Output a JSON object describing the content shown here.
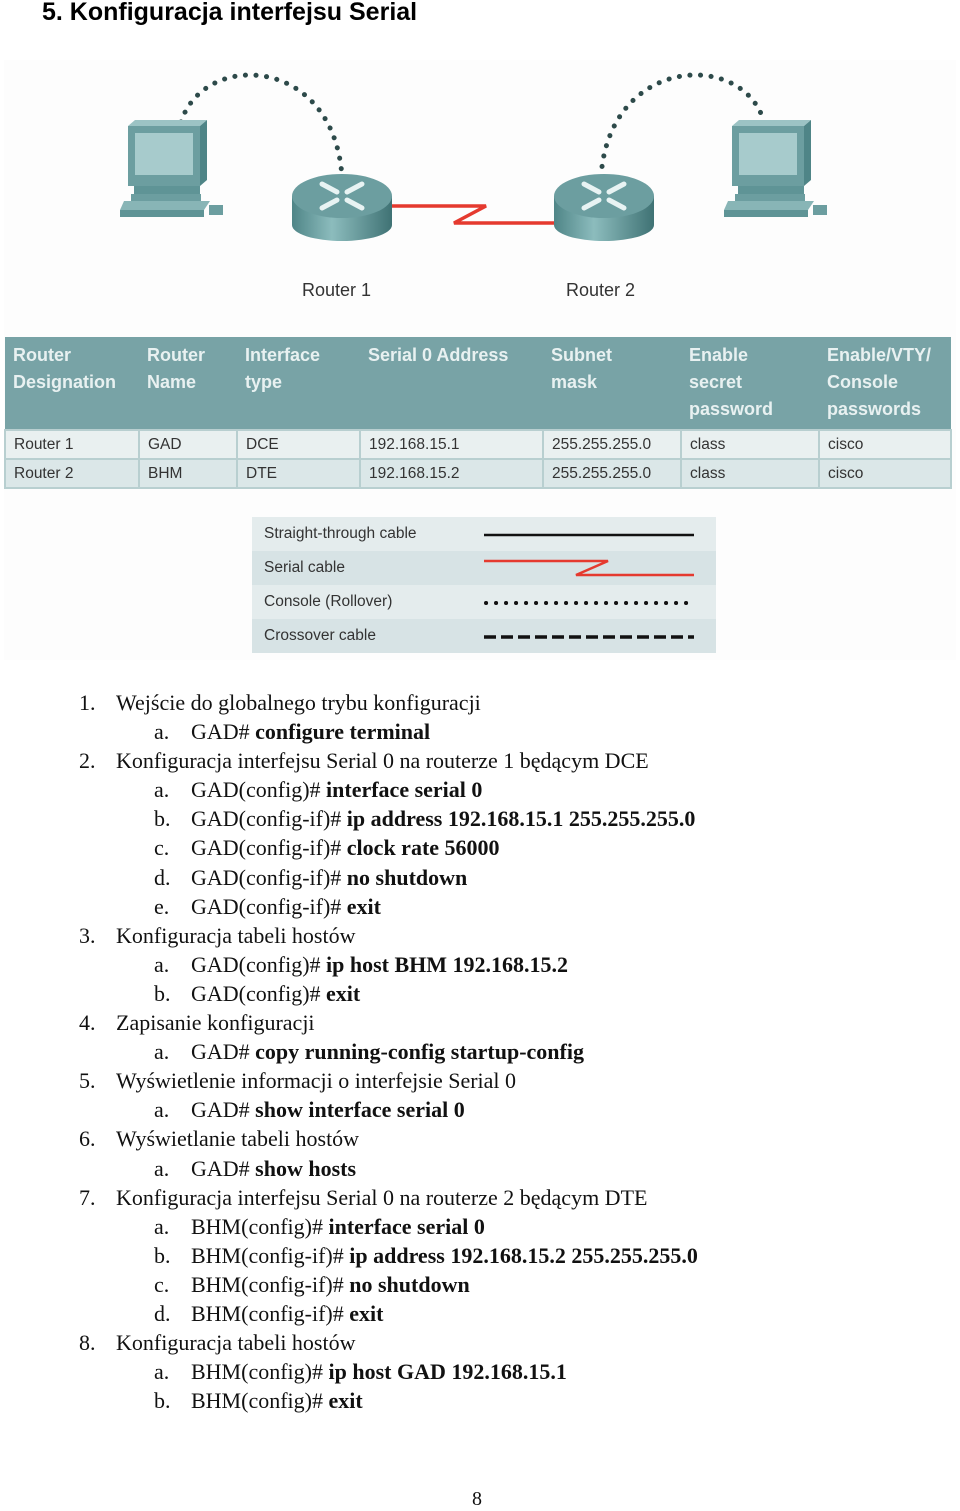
{
  "heading": "5.  Konfiguracja interfejsu Serial",
  "diagram": {
    "routers": [
      {
        "label": "Router 1"
      },
      {
        "label": "Router 2"
      }
    ],
    "link_type": "serial",
    "console_links": 2,
    "colors": {
      "device": "#5f9496",
      "serial": "#e53a2f",
      "console": "#2d4a4a"
    }
  },
  "table": {
    "headers": [
      [
        "Router",
        "Designation"
      ],
      [
        "Router",
        "Name"
      ],
      [
        "Interface",
        "type"
      ],
      [
        "Serial 0 Address"
      ],
      [
        "Subnet",
        "mask"
      ],
      [
        "Enable",
        "secret",
        "password"
      ],
      [
        "Enable/VTY/",
        "Console",
        "passwords"
      ]
    ],
    "rows": [
      [
        "Router 1",
        "GAD",
        "DCE",
        "192.168.15.1",
        "255.255.255.0",
        "class",
        "cisco"
      ],
      [
        "Router 2",
        "BHM",
        "DTE",
        "192.168.15.2",
        "255.255.255.0",
        "class",
        "cisco"
      ]
    ]
  },
  "legend": [
    {
      "label": "Straight-through cable",
      "style": "solid"
    },
    {
      "label": "Serial cable",
      "style": "serial"
    },
    {
      "label": "Console (Rollover)",
      "style": "dotted"
    },
    {
      "label": "Crossover cable",
      "style": "dashed"
    }
  ],
  "steps": [
    {
      "num": "1.",
      "title": "Wejście do globalnego trybu konfiguracji",
      "items": [
        {
          "letter": "a.",
          "prompt": "GAD# ",
          "cmd": "configure terminal"
        }
      ]
    },
    {
      "num": "2.",
      "title": "Konfiguracja interfejsu Serial 0 na routerze 1 będącym DCE",
      "items": [
        {
          "letter": "a.",
          "prompt": "GAD(config)# ",
          "cmd": "interface serial 0"
        },
        {
          "letter": "b.",
          "prompt": "GAD(config-if)# ",
          "cmd": "ip address 192.168.15.1 255.255.255.0"
        },
        {
          "letter": "c.",
          "prompt": "GAD(config-if)# ",
          "cmd": "clock rate 56000"
        },
        {
          "letter": "d.",
          "prompt": "GAD(config-if)# ",
          "cmd": "no shutdown"
        },
        {
          "letter": "e.",
          "prompt": "GAD(config-if)# ",
          "cmd": "exit"
        }
      ]
    },
    {
      "num": "3.",
      "title": "Konfiguracja tabeli hostów",
      "items": [
        {
          "letter": "a.",
          "prompt": "GAD(config)# ",
          "cmd": "ip host BHM 192.168.15.2"
        },
        {
          "letter": "b.",
          "prompt": "GAD(config)# ",
          "cmd": "exit"
        }
      ]
    },
    {
      "num": "4.",
      "title": "Zapisanie konfiguracji",
      "items": [
        {
          "letter": "a.",
          "prompt": "GAD# ",
          "cmd": "copy running-config startup-config"
        }
      ]
    },
    {
      "num": "5.",
      "title": "Wyświetlenie informacji o interfejsie Serial 0",
      "items": [
        {
          "letter": "a.",
          "prompt": "GAD# ",
          "cmd": "show interface serial 0"
        }
      ]
    },
    {
      "num": "6.",
      "title": "Wyświetlanie tabeli hostów",
      "items": [
        {
          "letter": "a.",
          "prompt": "GAD# ",
          "cmd": "show hosts"
        }
      ]
    },
    {
      "num": "7.",
      "title": "Konfiguracja interfejsu Serial 0 na routerze 2 będącym DTE",
      "items": [
        {
          "letter": "a.",
          "prompt": "BHM(config)# ",
          "cmd": "interface serial 0"
        },
        {
          "letter": "b.",
          "prompt": "BHM(config-if)# ",
          "cmd": "ip address 192.168.15.2 255.255.255.0"
        },
        {
          "letter": "c.",
          "prompt": "BHM(config-if)# ",
          "cmd": "no shutdown"
        },
        {
          "letter": "d.",
          "prompt": "BHM(config-if)# ",
          "cmd": "exit"
        }
      ]
    },
    {
      "num": "8.",
      "title": "Konfiguracja tabeli hostów",
      "items": [
        {
          "letter": "a.",
          "prompt": "BHM(config)# ",
          "cmd": "ip host GAD 192.168.15.1"
        },
        {
          "letter": "b.",
          "prompt": "BHM(config)# ",
          "cmd": "exit"
        }
      ]
    }
  ],
  "page_number": "8"
}
